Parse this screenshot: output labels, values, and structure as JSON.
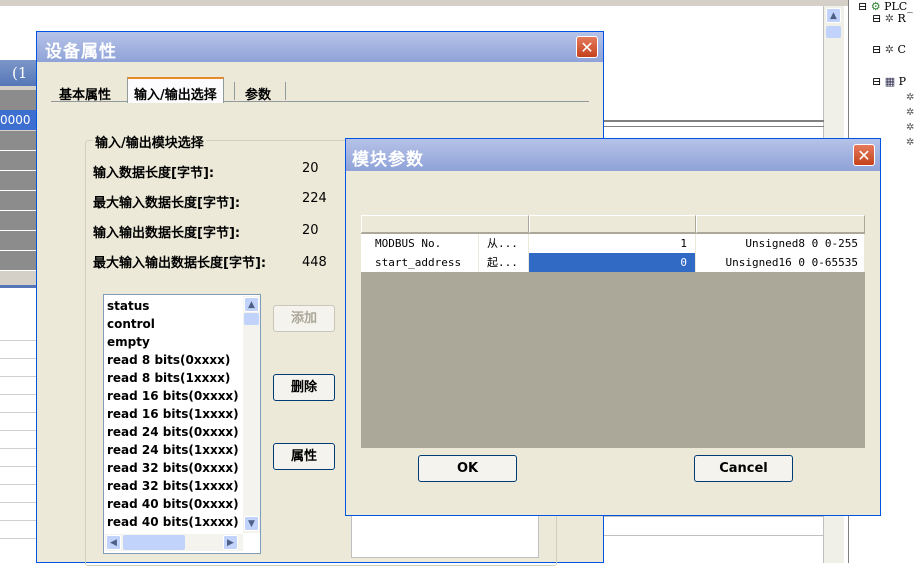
{
  "background": {
    "left_title_fragment": "(1",
    "left_value_fragment": "0000",
    "tree": {
      "items": [
        {
          "label": "PLC_",
          "icon": "plc-icon",
          "expander": "⊟"
        },
        {
          "label": "R",
          "icon": "network-icon",
          "expander": "⊟"
        },
        {
          "label": "C",
          "icon": "network-icon",
          "expander": "⊟"
        },
        {
          "label": "P",
          "icon": "bus-icon",
          "expander": "⊟"
        }
      ]
    }
  },
  "device_dialog": {
    "title": "设备属性",
    "close_label": "✕",
    "tabs": [
      {
        "label": "基本属性"
      },
      {
        "label": "输入/输出选择"
      },
      {
        "label": "参数"
      }
    ],
    "group_title": "输入/输出模块选择",
    "fields": [
      {
        "label": "输入数据长度[字节]:",
        "value": "20"
      },
      {
        "label": "最大输入数据长度[字节]:",
        "value": "224"
      },
      {
        "label": "输入输出数据长度[字节]:",
        "value": "20"
      },
      {
        "label": "最大输入输出数据长度[字节]:",
        "value": "448"
      }
    ],
    "module_list": [
      "status",
      "control",
      "empty",
      "read 8 bits(0xxxx)",
      "read 8 bits(1xxxx)",
      "read 16 bits(0xxxx)",
      "read 16 bits(1xxxx)",
      "read 24 bits(0xxxx)",
      "read 24 bits(1xxxx)",
      "read 32 bits(0xxxx)",
      "read 32 bits(1xxxx)",
      "read 40 bits(0xxxx)",
      "read 40 bits(1xxxx)"
    ],
    "buttons": {
      "add": "添加",
      "delete": "删除",
      "properties": "属性"
    }
  },
  "module_dialog": {
    "title": "模块参数",
    "close_label": "✕",
    "rows": [
      {
        "name": "MODBUS No.",
        "desc": "从...",
        "value": "1",
        "type": "Unsigned8 0 0-255",
        "selected": false
      },
      {
        "name": "start_address",
        "desc": "起...",
        "value": "0",
        "type": "Unsigned16 0 0-65535",
        "selected": true
      }
    ],
    "ok_label": "OK",
    "cancel_label": "Cancel"
  },
  "colors": {
    "title_bar": "#8fa3d8",
    "selection": "#316ac5",
    "dialog_face": "#ece9d8",
    "close_button": "#c4421b"
  }
}
